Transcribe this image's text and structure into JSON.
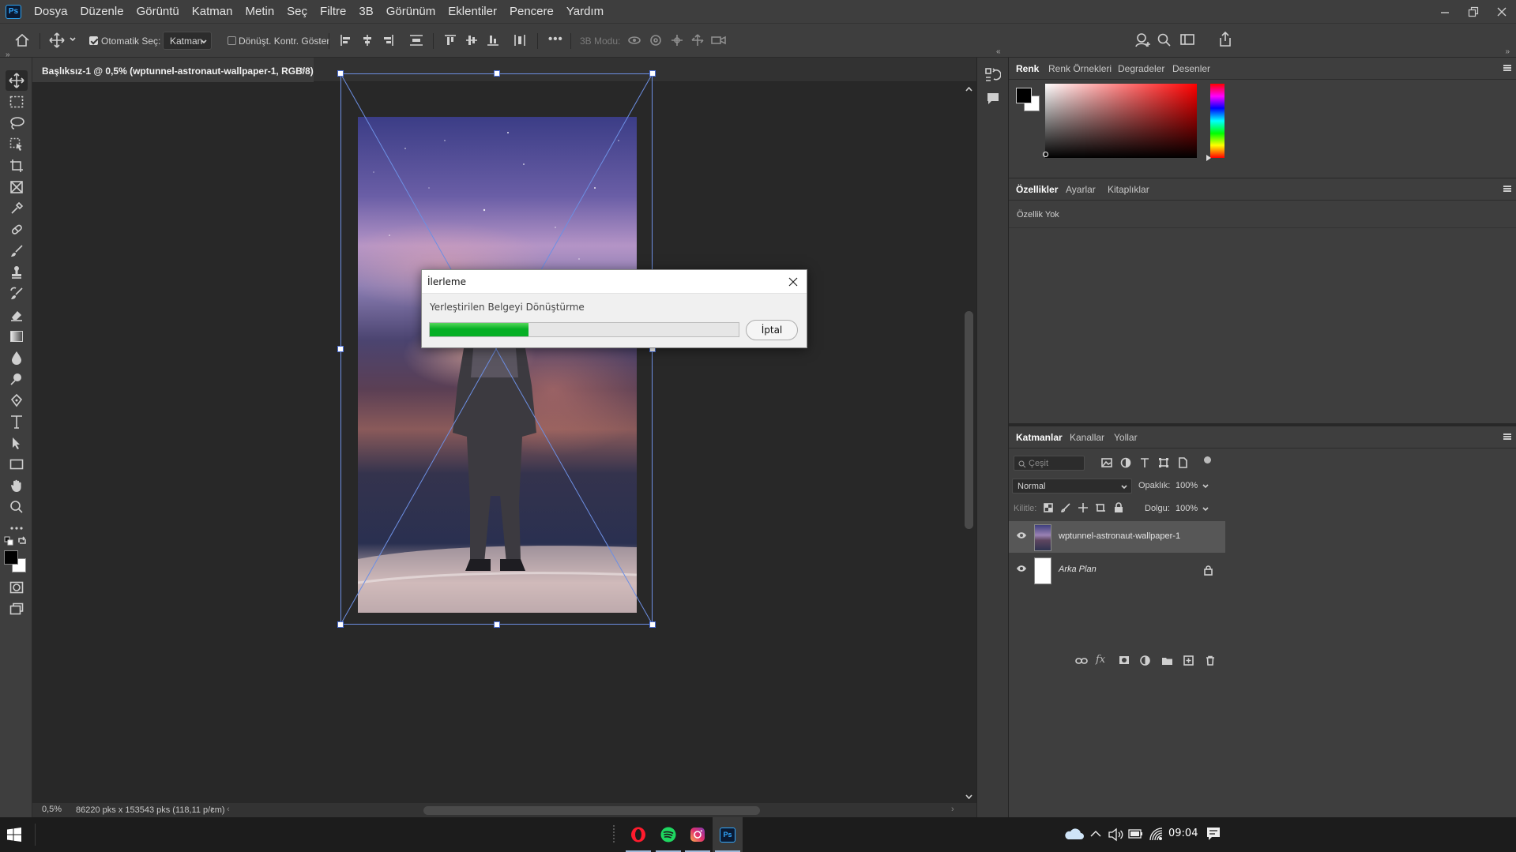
{
  "app": {
    "logo": "Ps"
  },
  "menu": [
    "Dosya",
    "Düzenle",
    "Görüntü",
    "Katman",
    "Metin",
    "Seç",
    "Filtre",
    "3B",
    "Görünüm",
    "Eklentiler",
    "Pencere",
    "Yardım"
  ],
  "options": {
    "auto_select_label": "Otomatik Seç:",
    "auto_select_checked": true,
    "auto_select_target": "Katman",
    "show_transform_label": "Dönüşt. Kontr. Göster",
    "show_transform_checked": false,
    "mode_3d_label": "3B Modu:",
    "more": "•••"
  },
  "document": {
    "tab_title": "Başlıksız-1 @ 0,5% (wptunnel-astronaut-wallpaper-1, RGB/8)",
    "close": "×"
  },
  "status": {
    "zoom": "0,5%",
    "info": "86220 pks x 153543 pks (118,11 p/cm)",
    "arrow": "›",
    "left_arrow": "‹"
  },
  "dialog": {
    "title": "İlerleme",
    "message": "Yerleştirilen Belgeyi Dönüştürme",
    "progress_fraction": 0.32,
    "cancel_label": "İptal"
  },
  "panels": {
    "color_tabs": [
      "Renk",
      "Renk Örnekleri",
      "Degradeler",
      "Desenler"
    ],
    "props_tabs": [
      "Özellikler",
      "Ayarlar",
      "Kitaplıklar"
    ],
    "props_empty": "Özellik Yok",
    "layers_tabs": [
      "Katmanlar",
      "Kanallar",
      "Yollar"
    ],
    "filter_placeholder": "Çeşit",
    "blend_mode": "Normal",
    "opacity_label": "Opaklık:",
    "opacity_value": "100%",
    "lock_label": "Kilitle:",
    "fill_label": "Dolgu:",
    "fill_value": "100%",
    "layers": [
      {
        "name": "wptunnel-astronaut-wallpaper-1",
        "selected": true
      },
      {
        "name": "Arka Plan",
        "locked": true
      }
    ]
  },
  "taskbar": {
    "time": "09:04"
  },
  "colors": {
    "accent": "#31a8ff",
    "progress": "#06b025",
    "transform_box": "#6d8fe3"
  }
}
